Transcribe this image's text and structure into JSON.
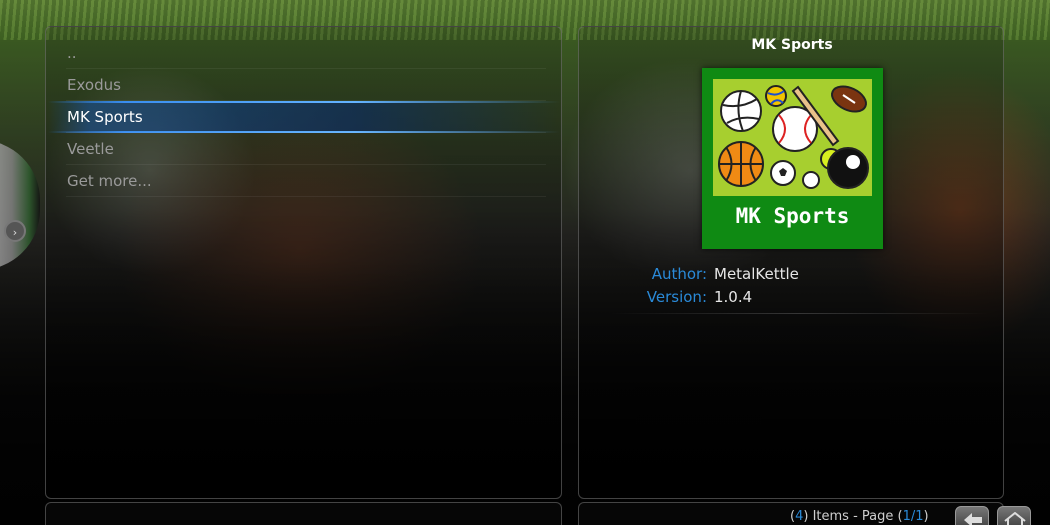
{
  "list": {
    "items": [
      {
        "label": ".."
      },
      {
        "label": "Exodus"
      },
      {
        "label": "MK Sports",
        "selected": true
      },
      {
        "label": "Veetle"
      },
      {
        "label": "Get more..."
      }
    ]
  },
  "info": {
    "title": "MK Sports",
    "thumbnail_caption": "MK Sports",
    "author_label": "Author:",
    "author_value": "MetalKettle",
    "version_label": "Version:",
    "version_value": "1.0.4"
  },
  "footer": {
    "count": "4",
    "items_text": "Items - Page",
    "page": "1/1",
    "back_icon": "back-arrow-icon",
    "home_icon": "home-icon"
  },
  "colors": {
    "accent": "#2a8ad8",
    "selection": "#1e5aa8",
    "thumb_bg": "#0f8a13",
    "thumb_inner": "#a7cf2f"
  }
}
